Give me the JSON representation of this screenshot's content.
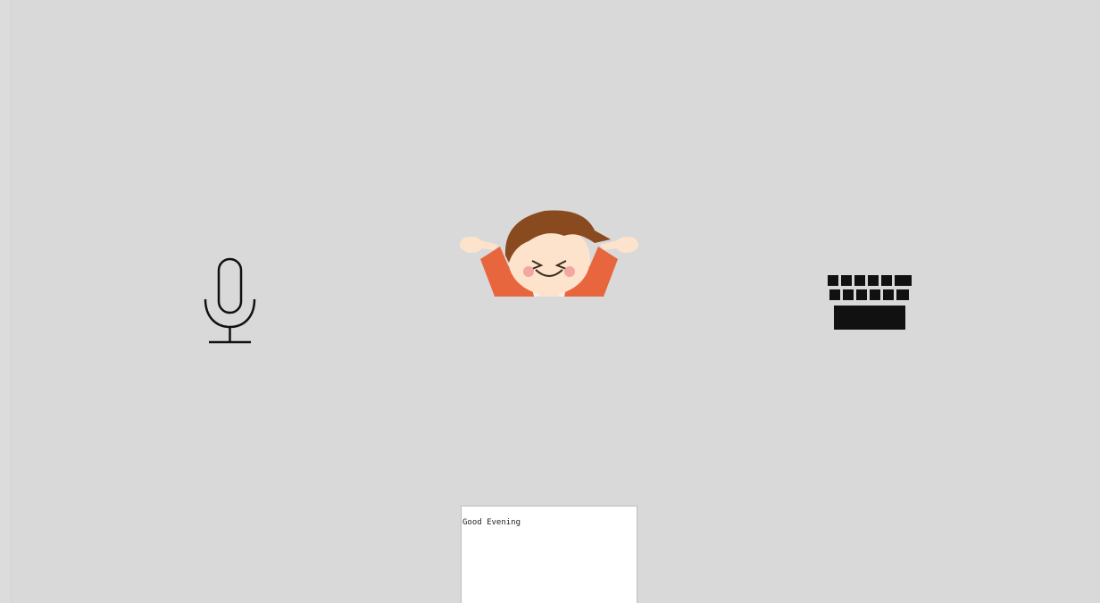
{
  "colors": {
    "background": "#d9d9d9",
    "icon": "#111111",
    "chat_box_background": "#ffffff",
    "chat_box_border": "#bdbdbd",
    "avatar_hair": "#8a4a1f",
    "avatar_skin": "#fde3cc",
    "avatar_shirt": "#e8663e",
    "avatar_cheeks": "#f4a6a0"
  },
  "controls": {
    "microphone_icon": "microphone-icon",
    "keyboard_icon": "keyboard-icon"
  },
  "avatar": {
    "icon": "cartoon-child-avatar"
  },
  "chat": {
    "message": "Good Evening"
  }
}
